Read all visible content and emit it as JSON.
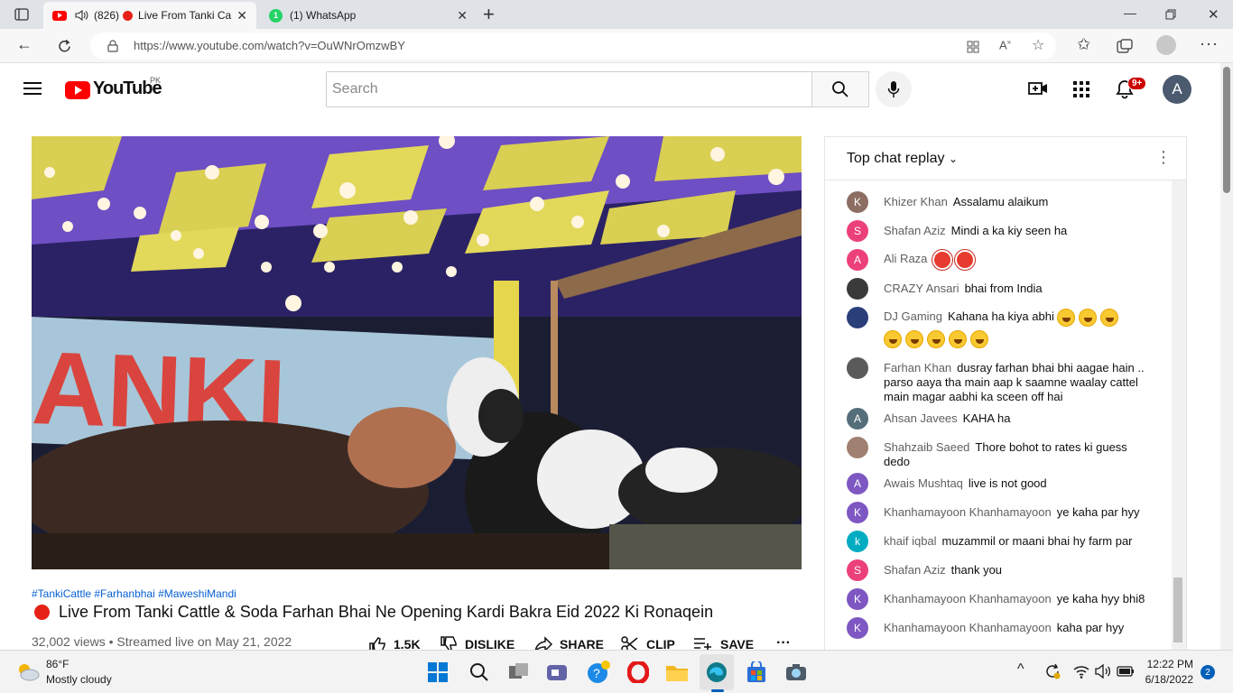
{
  "browser": {
    "tabs": [
      {
        "audio_count": "(826)",
        "title": "Live From Tanki Ca"
      },
      {
        "title": "(1) WhatsApp",
        "badge": "1"
      }
    ],
    "url": "https://www.youtube.com/watch?v=OuWNrOmzwBY"
  },
  "youtube": {
    "logo": "YouTube",
    "country": "PK",
    "search_placeholder": "Search",
    "notifications_badge": "9+",
    "avatar_letter": "A"
  },
  "video": {
    "hashtags": "#TankiCattle #Farhanbhai #MaweshiMandi",
    "title": "Live From Tanki Cattle & Soda Farhan Bhai Ne Opening Kardi Bakra Eid 2022 Ki Ronaqein",
    "meta": "32,002 views • Streamed live on May 21, 2022",
    "banner_text": "ANKI",
    "actions": {
      "like": "1.5K",
      "dislike": "DISLIKE",
      "share": "SHARE",
      "clip": "CLIP",
      "save": "SAVE"
    }
  },
  "chat": {
    "title": "Top chat replay",
    "messages": [
      {
        "author": "Khizer Khan",
        "text": "Assalamu alaikum",
        "initial": "K",
        "color": "#8d6e63"
      },
      {
        "author": "Shafan Aziz",
        "text": "Mindi a ka kiy seen ha",
        "initial": "S",
        "color": "#ec407a"
      },
      {
        "author": "Ali Raza",
        "text": "",
        "initial": "A",
        "color": "#ec407a"
      },
      {
        "author": "CRAZY Ansari",
        "text": "bhai from India",
        "initial": "",
        "color": "#3a3a3a"
      },
      {
        "author": "DJ Gaming",
        "text": "Kahana ha kiya abhi",
        "initial": "",
        "color": "#2a3f7a"
      },
      {
        "author": "Farhan Khan",
        "text": "dusray farhan bhai bhi aagae hain .. parso aaya tha main aap k saamne waalay cattel main magar aabhi ka sceen off hai",
        "initial": "",
        "color": "#5a5a5a"
      },
      {
        "author": "Ahsan Javees",
        "text": "KAHA ha",
        "initial": "A",
        "color": "#546e7a"
      },
      {
        "author": "Shahzaib Saeed",
        "text": "Thore bohot to rates ki guess dedo",
        "initial": "",
        "color": "#a08070"
      },
      {
        "author": "Awais Mushtaq",
        "text": "live is not good",
        "initial": "A",
        "color": "#7e57c2"
      },
      {
        "author": "Khanhamayoon Khanhamayoon",
        "text": "ye kaha par hyy",
        "initial": "K",
        "color": "#7e57c2"
      },
      {
        "author": "khaif iqbal",
        "text": "muzammil or maani bhai hy farm par",
        "initial": "k",
        "color": "#00acc1"
      },
      {
        "author": "Shafan Aziz",
        "text": "thank you",
        "initial": "S",
        "color": "#ec407a"
      },
      {
        "author": "Khanhamayoon Khanhamayoon",
        "text": "ye kaha hyy bhi8",
        "initial": "K",
        "color": "#7e57c2"
      },
      {
        "author": "Khanhamayoon Khanhamayoon",
        "text": "kaha par hyy",
        "initial": "K",
        "color": "#7e57c2"
      }
    ]
  },
  "taskbar": {
    "weather_temp": "86°F",
    "weather_desc": "Mostly cloudy",
    "time": "12:22 PM",
    "date": "6/18/2022",
    "notif_count": "2"
  }
}
